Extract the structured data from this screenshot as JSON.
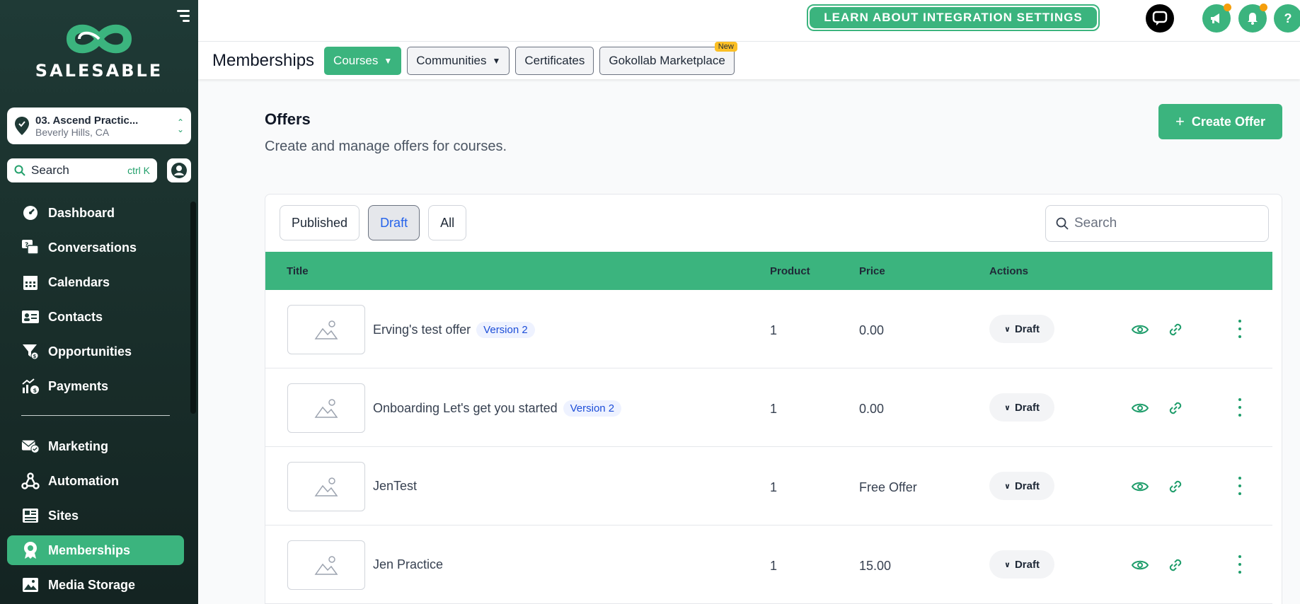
{
  "brand": {
    "name": "SALESABLE"
  },
  "location": {
    "name": "03. Ascend Practic...",
    "address": "Beverly Hills, CA"
  },
  "sidebar_search": {
    "label": "Search",
    "shortcut": "ctrl K"
  },
  "nav": {
    "primary": [
      {
        "label": "Dashboard",
        "icon": "dashboard-icon"
      },
      {
        "label": "Conversations",
        "icon": "chat-icon"
      },
      {
        "label": "Calendars",
        "icon": "calendar-icon"
      },
      {
        "label": "Contacts",
        "icon": "contacts-icon"
      },
      {
        "label": "Opportunities",
        "icon": "funnel-icon"
      },
      {
        "label": "Payments",
        "icon": "payments-icon"
      }
    ],
    "secondary": [
      {
        "label": "Marketing",
        "icon": "mail-icon"
      },
      {
        "label": "Automation",
        "icon": "automation-icon"
      },
      {
        "label": "Sites",
        "icon": "sites-icon"
      },
      {
        "label": "Memberships",
        "icon": "membership-icon",
        "active": true
      },
      {
        "label": "Media Storage",
        "icon": "image-icon"
      }
    ]
  },
  "topbar": {
    "learn_button": "LEARN ABOUT INTEGRATION SETTINGS"
  },
  "module_nav": {
    "title": "Memberships",
    "items": [
      {
        "label": "Courses",
        "dropdown": true,
        "active": true
      },
      {
        "label": "Communities",
        "dropdown": true
      },
      {
        "label": "Certificates"
      },
      {
        "label": "Gokollab Marketplace",
        "badge": "New"
      }
    ]
  },
  "page": {
    "title": "Offers",
    "subtitle": "Create and manage offers for courses.",
    "create_button": "Create Offer"
  },
  "filters": {
    "tabs": [
      "Published",
      "Draft",
      "All"
    ],
    "active": "Draft"
  },
  "table_search": {
    "placeholder": "Search"
  },
  "table": {
    "columns": [
      "Title",
      "Product",
      "Price",
      "Actions"
    ],
    "rows": [
      {
        "title": "Erving's test offer",
        "version": "Version 2",
        "product": "1",
        "price": "0.00",
        "status": "Draft"
      },
      {
        "title": "Onboarding Let's get you started",
        "version": "Version 2",
        "product": "1",
        "price": "0.00",
        "status": "Draft"
      },
      {
        "title": "JenTest",
        "version": "",
        "product": "1",
        "price": "Free Offer",
        "status": "Draft"
      },
      {
        "title": "Jen Practice",
        "version": "",
        "product": "1",
        "price": "15.00",
        "status": "Draft"
      }
    ]
  },
  "colors": {
    "brand_green": "#3bb47e",
    "sidebar_dark": "#1f3a36",
    "accent_orange": "#f59e0b",
    "link_blue": "#2563eb"
  }
}
